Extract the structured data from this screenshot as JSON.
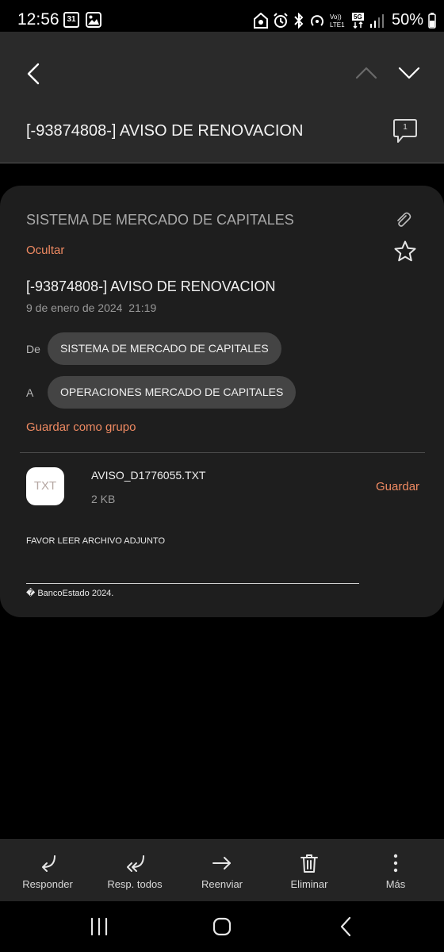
{
  "status_bar": {
    "time": "12:56",
    "calendar_day": "31",
    "battery": "50%"
  },
  "header": {
    "title": "[-93874808-] AVISO DE RENOVACION",
    "comment_count": "1"
  },
  "email": {
    "sender_name": "SISTEMA DE MERCADO DE CAPITALES",
    "hide_label": "Ocultar",
    "subject": "[-93874808-] AVISO DE RENOVACION",
    "date_time": "9 de enero de 2024  21:19",
    "from_label": "De",
    "from_value": "SISTEMA DE MERCADO DE CAPITALES",
    "to_label": "A",
    "to_value": "OPERACIONES MERCADO DE CAPITALES",
    "save_group_label": "Guardar como grupo"
  },
  "attachment": {
    "type_label": "TXT",
    "file_name": "AVISO_D1776055.TXT",
    "file_size": "2 KB",
    "save_label": "Guardar"
  },
  "body": {
    "text": "FAVOR LEER ARCHIVO ADJUNTO",
    "footer": "� BancoEstado 2024."
  },
  "toolbar": {
    "reply": "Responder",
    "reply_all": "Resp. todos",
    "forward": "Reenviar",
    "delete": "Eliminar",
    "more": "Más"
  },
  "colors": {
    "accent": "#ef8a62",
    "header_bg": "#2a2a2a",
    "card_bg": "#1e1e1e",
    "chip_bg": "#444444"
  }
}
